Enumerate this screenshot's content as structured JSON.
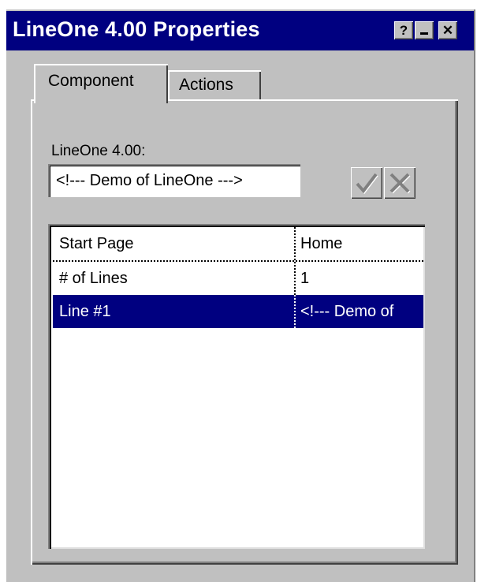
{
  "window": {
    "title": "LineOne 4.00 Properties",
    "help_glyph": "?",
    "close_glyph": "✕"
  },
  "tabs": [
    {
      "label": "Component",
      "selected": true
    },
    {
      "label": "Actions",
      "selected": false
    }
  ],
  "field": {
    "label": "LineOne 4.00:",
    "value": "<!--- Demo of LineOne --->"
  },
  "buttons": {
    "accept_icon": "check-icon",
    "cancel_icon": "x-icon"
  },
  "properties": {
    "rows": [
      {
        "name": "Start Page",
        "value": "Home"
      },
      {
        "name": "# of Lines",
        "value": "1"
      },
      {
        "name": "Line #1",
        "value": "<!--- Demo of",
        "selected": true
      }
    ]
  },
  "colors": {
    "titlebar": "#000080",
    "face": "#c0c0c0",
    "selection": "#000080"
  }
}
